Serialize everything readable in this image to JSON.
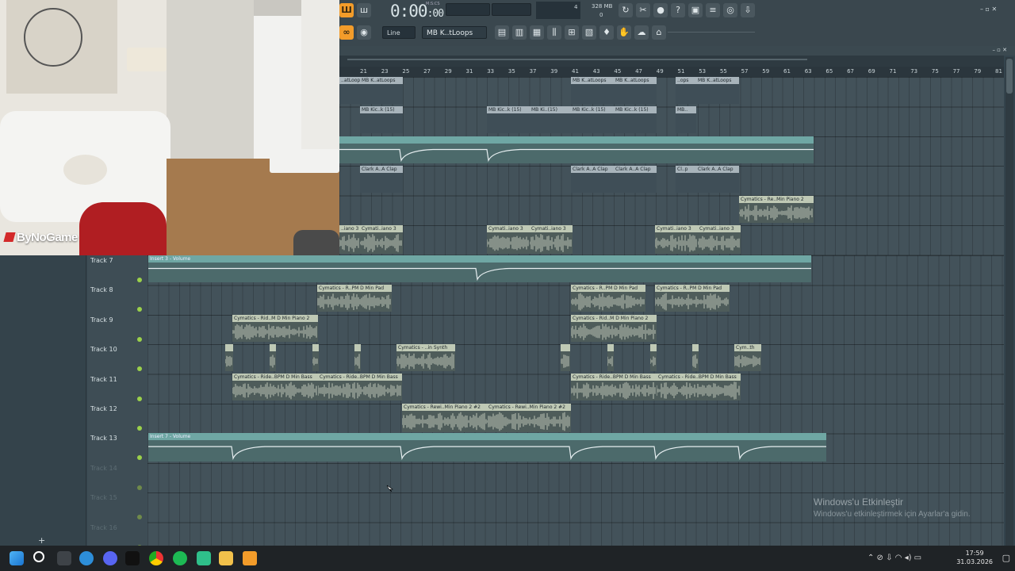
{
  "webcam": {
    "overlay_logo": "ByNoGame"
  },
  "toolbar": {
    "time": "0:00",
    "time_sub": ":00",
    "time_unit": "M:S:CS",
    "memory": "328 MB",
    "cpu_top": "4",
    "cpu_bottom": "0",
    "snap_mode": "Line",
    "pattern_name": "MB K..tLoops"
  },
  "playlist": {
    "ruler_numbers": [
      "21",
      "23",
      "25",
      "27",
      "29",
      "31",
      "33",
      "35",
      "37",
      "39",
      "41",
      "43",
      "45",
      "47",
      "49",
      "51",
      "53",
      "55",
      "57",
      "59",
      "61",
      "63",
      "65",
      "67",
      "69",
      "71",
      "73",
      "75",
      "77",
      "79",
      "81"
    ],
    "tracks": [
      {
        "name": "Track 7",
        "enabled": true
      },
      {
        "name": "Track 8",
        "enabled": true
      },
      {
        "name": "Track 9",
        "enabled": true
      },
      {
        "name": "Track 10",
        "enabled": true
      },
      {
        "name": "Track 11",
        "enabled": true
      },
      {
        "name": "Track 12",
        "enabled": true
      },
      {
        "name": "Track 13",
        "enabled": true
      },
      {
        "name": "Track 14",
        "enabled": false
      },
      {
        "name": "Track 15",
        "enabled": false
      },
      {
        "name": "Track 16",
        "enabled": false
      }
    ],
    "add_button": "+",
    "clips": {
      "upper_row1": [
        "..atLoops",
        "MB K..atLoops",
        "MB K..atLoops",
        "MB K..atLoops",
        "..ops",
        "MB K..atLoops"
      ],
      "upper_row2": [
        "MB Kic..k (15)",
        "MB Kic..k (15)",
        "MB Ki..(15)",
        "MB Kic..k (15)",
        "MB Kic..k (15)",
        "MB.."
      ],
      "upper_row4": [
        "Clark A..A Clap",
        "Clark A..A Clap",
        "Clark A..A Clap",
        "Cl..p",
        "Clark A..A Clap"
      ],
      "upper_row5": [
        "Cymatics - Re..Min Piano 2"
      ],
      "upper_row6": [
        "..iano 3",
        "Cymati..iano 3",
        "Cymati..iano 3",
        "Cymati..iano 3",
        "Cymati..iano 3",
        "Cymati..iano 3"
      ],
      "track7": "Insert 3 - Volume",
      "track8": [
        "Cymatics - R..PM D Min Pad",
        "Cymatics - R..PM D Min Pad",
        "Cymatics - R..PM D Min Pad"
      ],
      "track9": [
        "Cymatics - Rid..M D Min Piano 2",
        "Cymatics - Rid..M D Min Piano 2"
      ],
      "track10": [
        "Cymatics - ..in Synth",
        "Cym..th"
      ],
      "track11": [
        "Cymatics - Ride..BPM D Min Bass",
        "Cymatics - Ride..BPM D Min Bass",
        "Cymatics - Ride..BPM D Min Bass",
        "Cymatics - Ride..BPM D Min Bass"
      ],
      "track12": [
        "Cymatics - Rewi..Min Piano 2 #2",
        "Cymatics - Rewi..Min Piano 2 #2"
      ],
      "track13": "Insert 7 - Volume"
    }
  },
  "overlay": {
    "watermark_title": "Windows'u Etkinleştir",
    "watermark_sub": "Windows'u etkinleştirmek için Ayarlar'a gidin."
  },
  "taskbar": {
    "time": "17:59",
    "date": "31.03.2026"
  }
}
